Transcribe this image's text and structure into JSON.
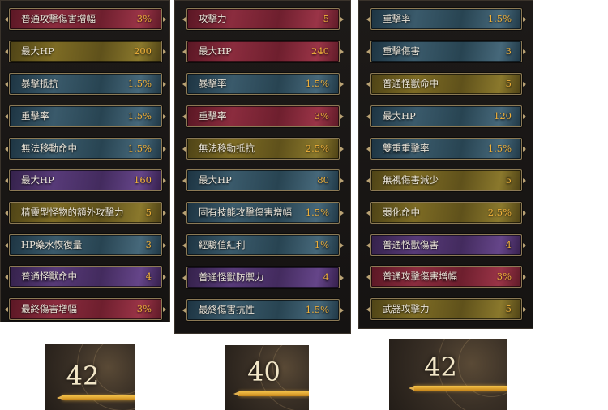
{
  "columns": [
    {
      "rows": [
        {
          "label": "普通攻擊傷害增幅",
          "value": "3%",
          "color": "red"
        },
        {
          "label": "最大HP",
          "value": "200",
          "color": "gold"
        },
        {
          "label": "暴擊抵抗",
          "value": "1.5%",
          "color": "blue"
        },
        {
          "label": "重擊率",
          "value": "1.5%",
          "color": "blue"
        },
        {
          "label": "無法移動命中",
          "value": "1.5%",
          "color": "blue"
        },
        {
          "label": "最大HP",
          "value": "160",
          "color": "purple"
        },
        {
          "label": "精靈型怪物的額外攻擊力",
          "value": "5",
          "color": "gold"
        },
        {
          "label": "HP藥水恢復量",
          "value": "3",
          "color": "blue"
        },
        {
          "label": "普通怪獸命中",
          "value": "4",
          "color": "purple"
        },
        {
          "label": "最終傷害增幅",
          "value": "3%",
          "color": "red"
        }
      ]
    },
    {
      "rows": [
        {
          "label": "攻擊力",
          "value": "5",
          "color": "red"
        },
        {
          "label": "最大HP",
          "value": "240",
          "color": "red"
        },
        {
          "label": "暴擊率",
          "value": "1.5%",
          "color": "blue"
        },
        {
          "label": "重擊率",
          "value": "3%",
          "color": "red"
        },
        {
          "label": "無法移動抵抗",
          "value": "2.5%",
          "color": "gold"
        },
        {
          "label": "最大HP",
          "value": "80",
          "color": "blue"
        },
        {
          "label": "固有技能攻擊傷害增幅",
          "value": "1.5%",
          "color": "blue"
        },
        {
          "label": "經驗值紅利",
          "value": "1%",
          "color": "blue"
        },
        {
          "label": "普通怪獸防禦力",
          "value": "4",
          "color": "purple"
        },
        {
          "label": "最終傷害抗性",
          "value": "1.5%",
          "color": "blue"
        }
      ]
    },
    {
      "rows": [
        {
          "label": "重擊率",
          "value": "1.5%",
          "color": "blue"
        },
        {
          "label": "重擊傷害",
          "value": "3",
          "color": "blue"
        },
        {
          "label": "普通怪獸命中",
          "value": "5",
          "color": "gold"
        },
        {
          "label": "最大HP",
          "value": "120",
          "color": "blue"
        },
        {
          "label": "雙重重擊率",
          "value": "1.5%",
          "color": "blue"
        },
        {
          "label": "無視傷害減少",
          "value": "5",
          "color": "gold"
        },
        {
          "label": "弱化命中",
          "value": "2.5%",
          "color": "gold"
        },
        {
          "label": "普通怪獸傷害",
          "value": "4",
          "color": "purple"
        },
        {
          "label": "普通攻擊傷害增幅",
          "value": "3%",
          "color": "red"
        },
        {
          "label": "武器攻擊力",
          "value": "5",
          "color": "gold"
        }
      ]
    }
  ],
  "levels": [
    {
      "value": "42"
    },
    {
      "value": "40"
    },
    {
      "value": "42"
    }
  ],
  "colors": {
    "value_text": "#f2b23a",
    "label_text": "#ece6da",
    "red": "#8b2c3e",
    "gold": "#7d6b24",
    "blue": "#3a5a6b",
    "purple": "#573a78"
  }
}
